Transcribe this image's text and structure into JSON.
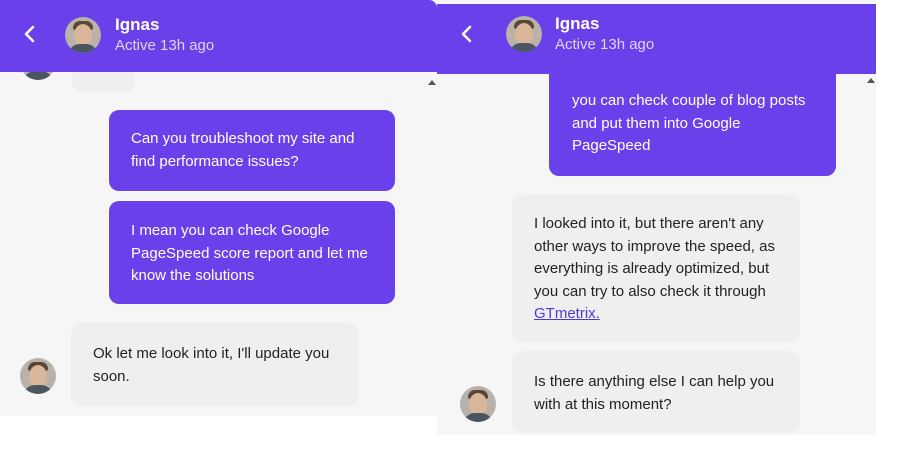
{
  "left_panel": {
    "header": {
      "name": "Ignas",
      "status": "Active 13h ago"
    },
    "messages": [
      {
        "type": "outgoing",
        "text": "Can you troubleshoot my site and find performance issues?"
      },
      {
        "type": "outgoing",
        "text": "I mean you can check Google PageSpeed score report and let me know the solutions"
      },
      {
        "type": "incoming",
        "text": "Ok let me look into it, I'll update you soon."
      }
    ]
  },
  "right_panel": {
    "header": {
      "name": "Ignas",
      "status": "Active 13h ago"
    },
    "messages": [
      {
        "type": "outgoing",
        "text": "you can check couple of blog posts and put them into Google PageSpeed"
      },
      {
        "type": "incoming",
        "text": "I looked into it, but there aren't any other ways to improve the speed, as everything is already optimized, but you can try to also check it through ",
        "link": "GTmetrix."
      },
      {
        "type": "incoming",
        "text": "Is there anything else I can help you with at this moment?"
      }
    ]
  },
  "colors": {
    "accent": "#6a40ea",
    "incoming_bubble": "#efefef",
    "background": "#f6f6f6"
  },
  "icons": {
    "back": "chevron-left-icon",
    "avatar": "user-avatar"
  }
}
